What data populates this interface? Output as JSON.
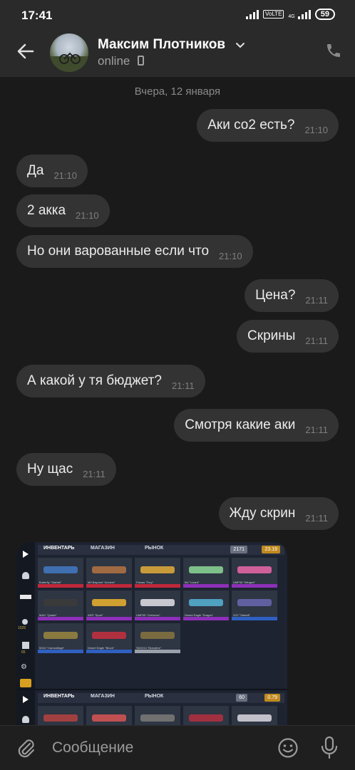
{
  "status_bar": {
    "time": "17:41",
    "network_badge": "VoLTE",
    "network_type": "4G",
    "battery": "59"
  },
  "header": {
    "contact_name": "Максим Плотников",
    "contact_status": "online"
  },
  "date_separator": "Вчера, 12 января",
  "messages": [
    {
      "side": "out",
      "text": "Аки со2 есть?",
      "time": "21:10"
    },
    {
      "side": "in",
      "text": "Да",
      "time": "21:10"
    },
    {
      "side": "in",
      "text": "2 акка",
      "time": "21:10"
    },
    {
      "side": "in",
      "text": "Но они варованные если что",
      "time": "21:10"
    },
    {
      "side": "out",
      "text": "Цена?",
      "time": "21:11"
    },
    {
      "side": "out",
      "text": "Скрины",
      "time": "21:11"
    },
    {
      "side": "in",
      "text": "А какой у тя бюджет?",
      "time": "21:11"
    },
    {
      "side": "out",
      "text": "Смотря какие аки",
      "time": "21:11"
    },
    {
      "side": "in",
      "text": "Ну щас",
      "time": "21:11"
    },
    {
      "side": "out",
      "text": "Жду скрин",
      "time": "21:11"
    }
  ],
  "attachment": {
    "tabs": [
      "ИНВЕНТАРЬ",
      "МАГАЗИН",
      "РЫНОК"
    ],
    "balance_silver": "2171",
    "balance_gold": "23.19",
    "balance_silver_2": "60",
    "balance_gold_2": "0.79",
    "side_counts": [
      "1025",
      "65"
    ],
    "items": [
      {
        "name": "Butterfly \"Starfall\"",
        "color": "#c0283a",
        "gun": "#3f6fb0"
      },
      {
        "name": "M9 Bayonet \"Ancient\"",
        "color": "#c0283a",
        "gun": "#a06a42"
      },
      {
        "name": "Famas \"Fury\"",
        "color": "#c0283a",
        "gun": "#c79a3a"
      },
      {
        "name": "M4 \"Lizard\"",
        "color": "#8e2fb8",
        "gun": "#7ec08a"
      },
      {
        "name": "UMP45 \"Winged\"",
        "color": "#8e2fb8",
        "gun": "#d0609a"
      },
      {
        "name": "MAG \"Quake\"",
        "color": "#8e2fb8",
        "gun": "#3a3a3a"
      },
      {
        "name": "AKR \"Sport\"",
        "color": "#8e2fb8",
        "gun": "#d0a030"
      },
      {
        "name": "UMP45 \"Cerberus\"",
        "color": "#8e2fb8",
        "gun": "#c8c8d0"
      },
      {
        "name": "Desert Eagle \"Dragon\"",
        "color": "#8e2fb8",
        "gun": "#50a0c0"
      },
      {
        "name": "G22 \"Starfall\"",
        "color": "#2f5fc0",
        "gun": "#6060a0"
      },
      {
        "name": "M110 \"Camouflage\"",
        "color": "#2f5fc0",
        "gun": "#8a7a40"
      },
      {
        "name": "Desert Eagle \"Blood\"",
        "color": "#2f5fc0",
        "gun": "#b03040"
      },
      {
        "name": "SM1014 \"Brassline\"",
        "color": "#9aa0aa",
        "gun": "#7a6a40"
      }
    ],
    "row2_items": [
      {
        "gun": "#a04040"
      },
      {
        "gun": "#c05050"
      },
      {
        "gun": "#707070"
      },
      {
        "gun": "#a03040"
      },
      {
        "gun": "#c0c0c8"
      }
    ]
  },
  "composer": {
    "placeholder": "Сообщение"
  },
  "colors": {
    "background": "#1a1a1b",
    "bar": "#2a2a2b",
    "bubble": "#333334"
  }
}
